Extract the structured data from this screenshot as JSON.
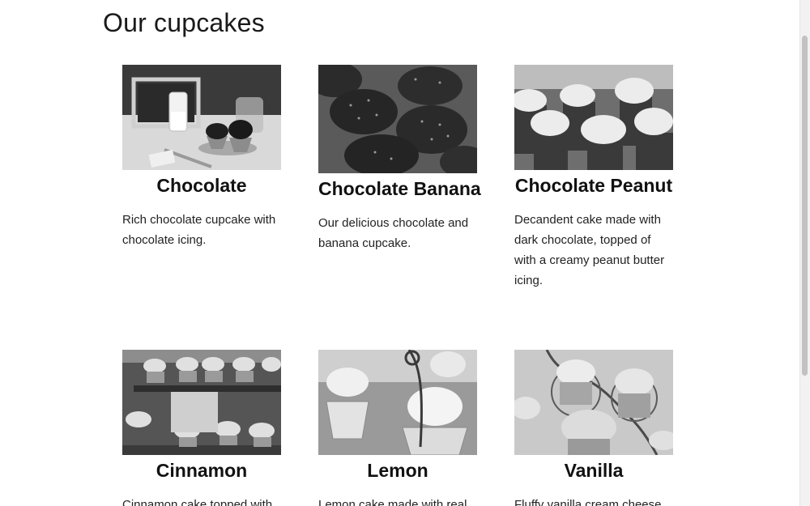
{
  "page": {
    "title": "Our cupcakes"
  },
  "cupcakes": [
    {
      "name": "Chocolate",
      "description": "Rich chocolate cupcake with chocolate icing.",
      "photo": "cupcakes-with-milk-bottle-photo"
    },
    {
      "name": "Chocolate Banana",
      "description": "Our delicious chocolate and banana cupcake.",
      "photo": "sprinkled-chocolate-cupcakes-photo"
    },
    {
      "name": "Chocolate Peanut",
      "description": "Decandent cake made with dark chocolate, topped of with a creamy peanut butter icing.",
      "photo": "frosted-cupcakes-row-photo"
    },
    {
      "name": "Cinnamon",
      "description": "Cinnamon cake topped with",
      "photo": "cupcake-stand-tiers-photo"
    },
    {
      "name": "Lemon",
      "description": "Lemon cake made with real",
      "photo": "lemon-cupcakes-lace-wrappers-photo"
    },
    {
      "name": "Vanilla",
      "description": "Fluffy vanilla cream cheese",
      "photo": "vanilla-cupcakes-wire-stand-photo"
    }
  ]
}
